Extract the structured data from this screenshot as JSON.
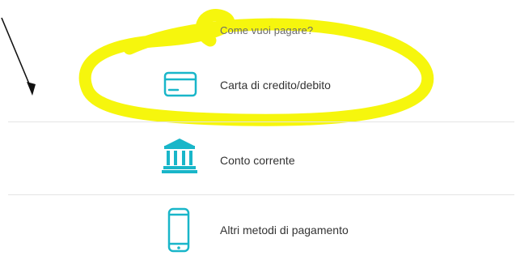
{
  "prompt": "Come vuoi pagare?",
  "options": [
    {
      "label": "Carta di credito/debito",
      "icon": "credit-card-icon"
    },
    {
      "label": "Conto corrente",
      "icon": "bank-icon"
    },
    {
      "label": "Altri metodi di pagamento",
      "icon": "smartphone-icon"
    }
  ],
  "colors": {
    "accent": "#19b6c9",
    "highlight": "#f5f500",
    "divider": "#e4e4e4",
    "arrow": "#111111"
  }
}
